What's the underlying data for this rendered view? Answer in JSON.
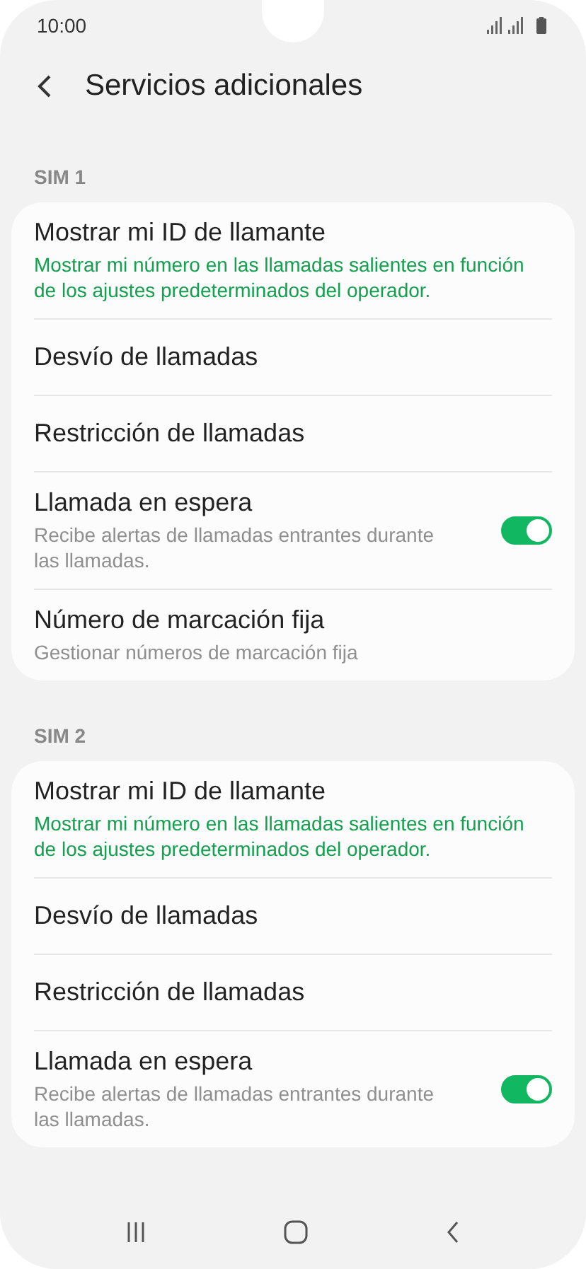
{
  "status_bar": {
    "time": "10:00"
  },
  "header": {
    "title": "Servicios adicionales"
  },
  "sections": [
    {
      "label": "SIM 1",
      "items": [
        {
          "kind": "accent",
          "title": "Mostrar mi ID de llamante",
          "subtitle": "Mostrar mi número en las llamadas salientes en función de los ajustes predeterminados del operador."
        },
        {
          "kind": "plain",
          "title": "Desvío de llamadas"
        },
        {
          "kind": "plain",
          "title": "Restricción de llamadas"
        },
        {
          "kind": "toggle",
          "title": "Llamada en espera",
          "subtitle": "Recibe alertas de llamadas entrantes durante las llamadas.",
          "on": true
        },
        {
          "kind": "plain",
          "title": "Número de marcación fija",
          "subtitle": "Gestionar números de marcación fija"
        }
      ]
    },
    {
      "label": "SIM 2",
      "items": [
        {
          "kind": "accent",
          "title": "Mostrar mi ID de llamante",
          "subtitle": "Mostrar mi número en las llamadas salientes en función de los ajustes predeterminados del operador."
        },
        {
          "kind": "plain",
          "title": "Desvío de llamadas"
        },
        {
          "kind": "plain",
          "title": "Restricción de llamadas"
        },
        {
          "kind": "toggle",
          "title": "Llamada en espera",
          "subtitle": "Recibe alertas de llamadas entrantes durante las llamadas.",
          "on": true
        }
      ]
    }
  ]
}
